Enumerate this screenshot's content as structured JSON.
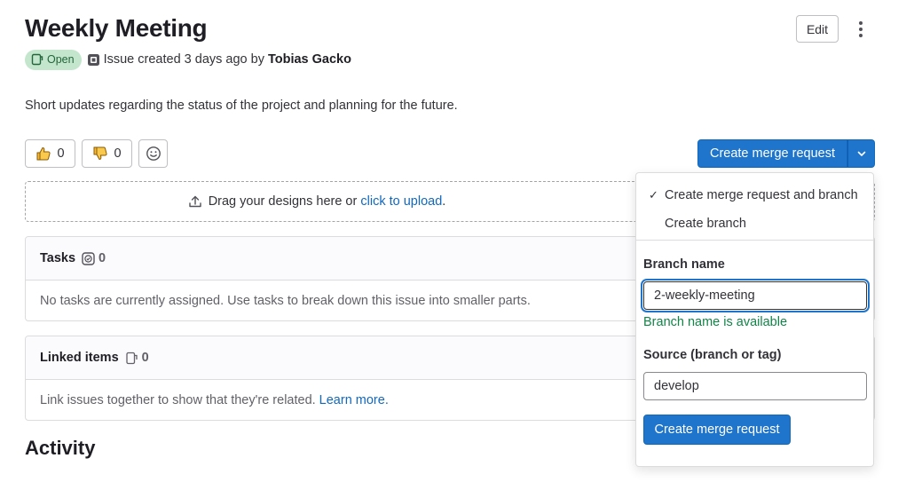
{
  "issue": {
    "title": "Weekly Meeting",
    "status": "Open",
    "meta_text": "Issue created 3 days ago by",
    "author": "Tobias Gacko",
    "description": "Short updates regarding the status of the project and planning for the future."
  },
  "header": {
    "edit_label": "Edit"
  },
  "reactions": {
    "thumbs_up_count": "0",
    "thumbs_down_count": "0"
  },
  "merge_request": {
    "button_label": "Create merge request",
    "dropdown": {
      "option_1": "Create merge request and branch",
      "option_1_checked": true,
      "option_2": "Create branch",
      "branch_label": "Branch name",
      "branch_value": "2-weekly-meeting",
      "branch_status": "Branch name is available",
      "source_label": "Source (branch or tag)",
      "source_value": "develop",
      "submit_label": "Create merge request"
    }
  },
  "upload": {
    "text": "Drag your designs here or",
    "link": "click to upload",
    "suffix": "."
  },
  "tasks": {
    "title": "Tasks",
    "count": "0",
    "empty_text": "No tasks are currently assigned. Use tasks to break down this issue into smaller parts."
  },
  "linked_items": {
    "title": "Linked items",
    "count": "0",
    "empty_text": "Link issues together to show that they're related.",
    "learn_more": "Learn more."
  },
  "activity": {
    "title": "Activity"
  },
  "colors": {
    "primary": "#1f75cb",
    "open_badge_bg": "#c3e6cd",
    "open_badge_text": "#24663b",
    "success_text": "#108548",
    "link": "#1068bf"
  }
}
